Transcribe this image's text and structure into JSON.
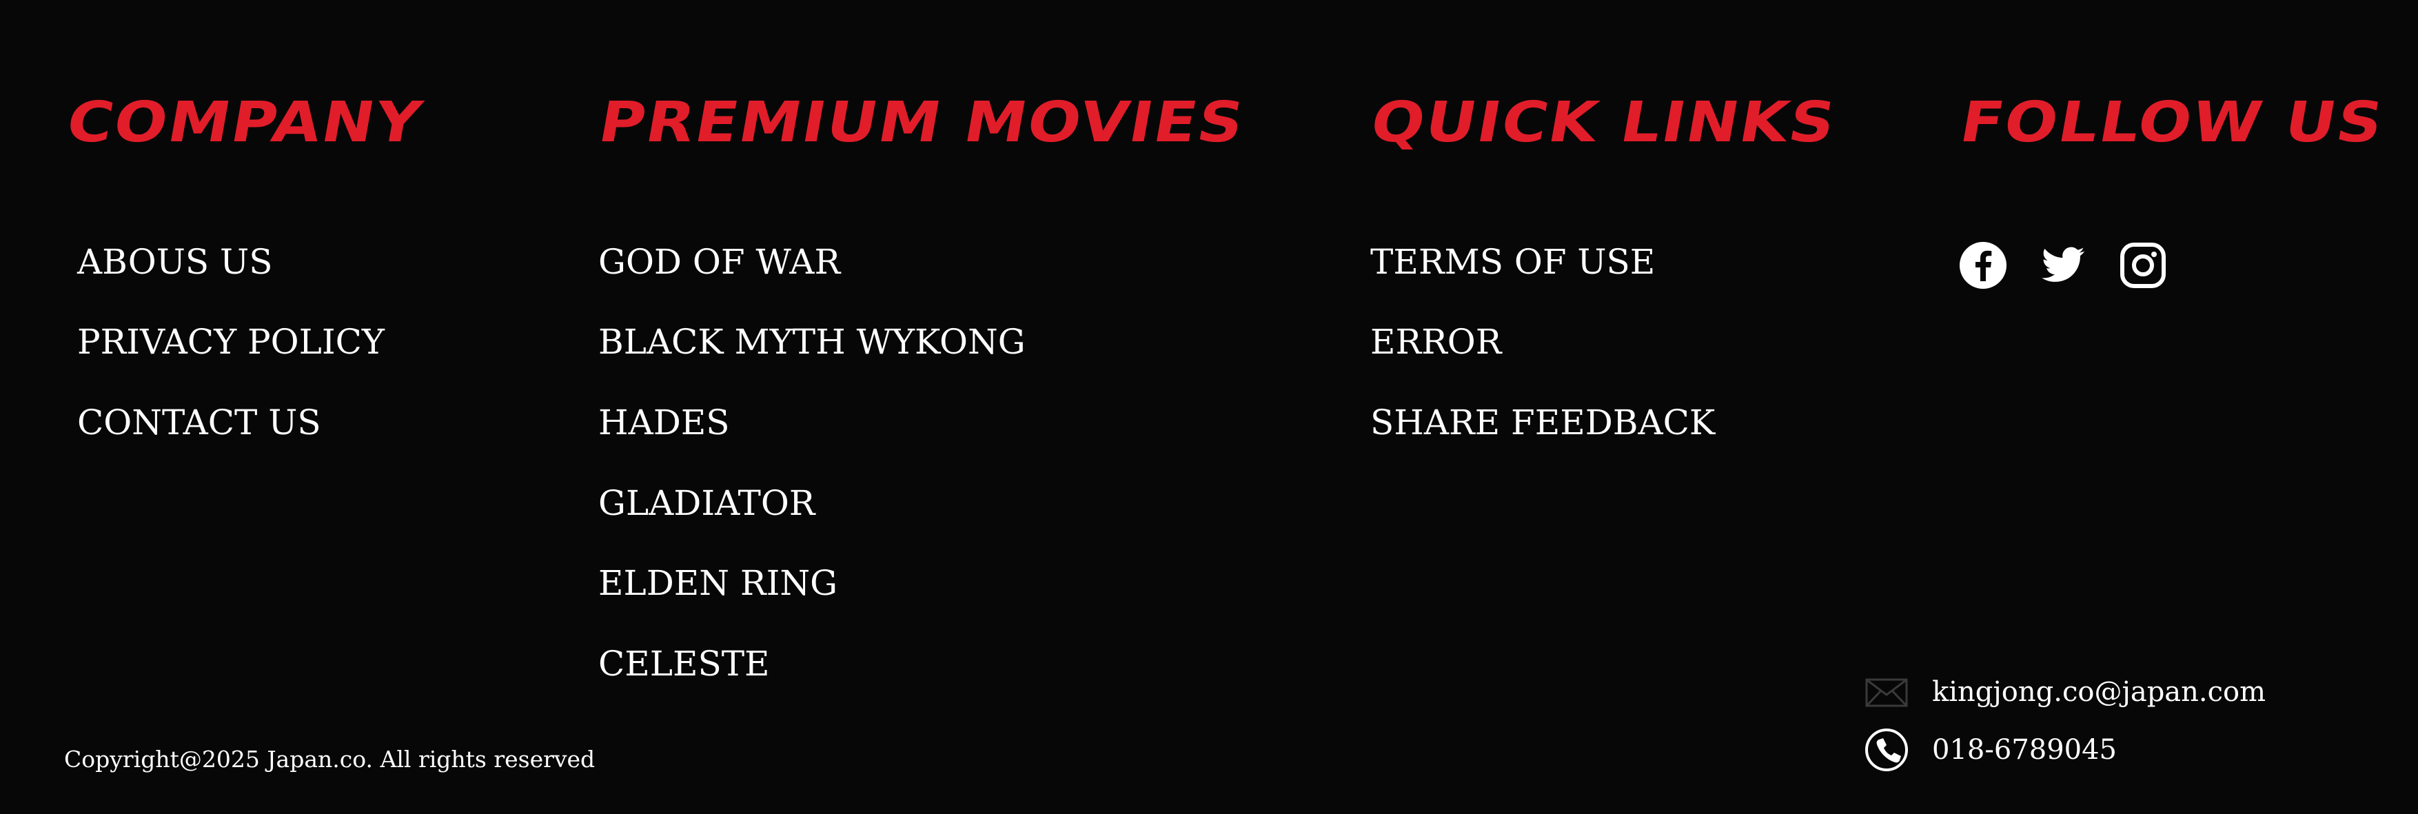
{
  "company": {
    "heading": "COMPANY",
    "links": [
      "ABOUS US",
      "PRIVACY POLICY",
      "CONTACT US"
    ]
  },
  "premium_movies": {
    "heading": "PREMIUM MOVIES",
    "links": [
      "GOD OF WAR",
      "BLACK MYTH WYKONG",
      "HADES",
      "GLADIATOR",
      "ELDEN RING",
      "CELESTE"
    ]
  },
  "quick_links": {
    "heading": "QUICK LINKS",
    "links": [
      "TERMS OF USE",
      "ERROR",
      "SHARE FEEDBACK"
    ]
  },
  "follow_us": {
    "heading": "FOLLOW US",
    "icons": [
      "facebook-icon",
      "twitter-icon",
      "instagram-icon"
    ]
  },
  "contact": {
    "email": "kingjong.co@japan.com",
    "phone": "018-6789045",
    "email_icon": "mail-icon",
    "phone_icon": "phone-icon"
  },
  "footer": {
    "copyright": "Copyright@2025  Japan.co. All rights reserved"
  },
  "colors": {
    "background": "#070707",
    "accent": "#e11d2a",
    "text": "#ffffff"
  }
}
